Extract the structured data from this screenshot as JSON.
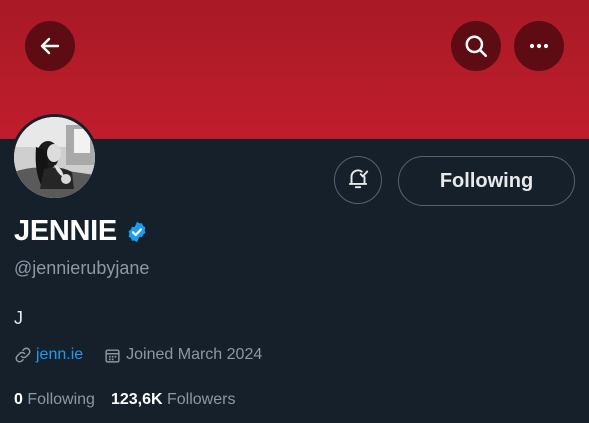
{
  "header": {
    "back_icon": "arrow-left-icon",
    "search_icon": "search-icon",
    "more_icon": "more-horizontal-icon",
    "banner_color": "#c01d2c"
  },
  "profile": {
    "name": "JENNIE",
    "handle": "@jennierubyjane",
    "bio": "J",
    "website": "jenn.ie",
    "joined": "Joined March 2024",
    "verified": true,
    "accent_color": "#1d9bf0"
  },
  "actions": {
    "notify_icon": "bell-check-icon",
    "follow_label": "Following"
  },
  "stats": {
    "following_count": "0",
    "following_label": "Following",
    "followers_count": "123,6K",
    "followers_label": "Followers"
  }
}
